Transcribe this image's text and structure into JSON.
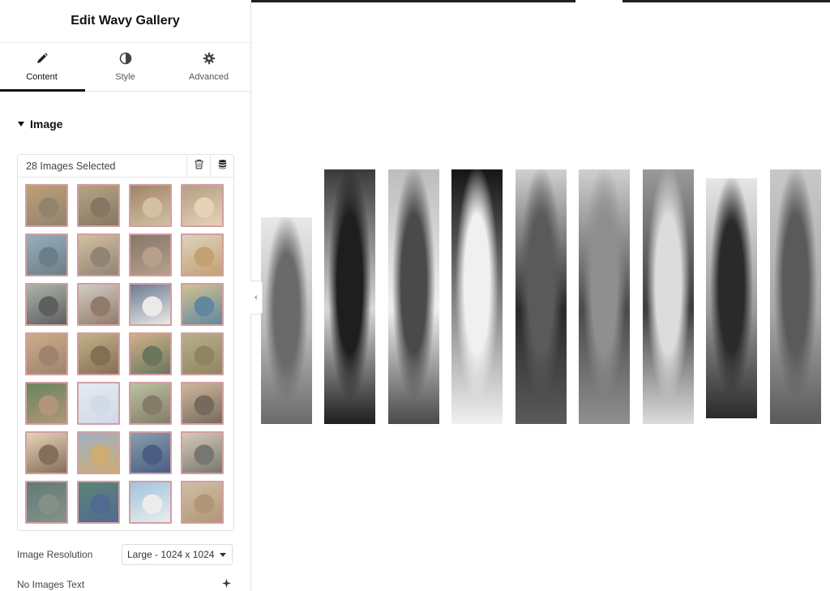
{
  "panel": {
    "title": "Edit Wavy Gallery",
    "tabs": [
      {
        "label": "Content",
        "icon": "pencil-icon",
        "active": true
      },
      {
        "label": "Style",
        "icon": "half-circle-icon",
        "active": false
      },
      {
        "label": "Advanced",
        "icon": "gear-icon",
        "active": false
      }
    ],
    "section_title": "Image",
    "gallery": {
      "count_label": "28 Images Selected",
      "delete_icon": "trash-icon",
      "dynamic_icon": "database-icon",
      "thumbnails": [
        "leopard",
        "lions",
        "bear",
        "monkey",
        "elephant",
        "elephant",
        "bear",
        "giraffe",
        "penguins",
        "deer",
        "polar bear",
        "kingfisher",
        "cougar",
        "horse",
        "tiger",
        "cat",
        "monkey",
        "arctic fox",
        "antelope",
        "leopard",
        "oryx",
        "giraffe",
        "peacock",
        "elephants",
        "fish",
        "peacock",
        "gulls",
        "cat"
      ]
    },
    "resolution": {
      "label": "Image Resolution",
      "value": "Large - 1024 x 1024"
    },
    "no_images": {
      "label": "No Images Text",
      "icon": "ai-sparkle-icon"
    },
    "collapse_icon": "chevron-left-icon"
  },
  "preview": {
    "strips": [
      "giraffe",
      "penguin",
      "flamingo",
      "dog",
      "kingfisher",
      "cougar",
      "horse",
      "tiger",
      "cat"
    ]
  },
  "colors": {
    "accent": "#111111",
    "thumb_border": "#c98a8f",
    "panel_divider": "#e9d6ea"
  }
}
